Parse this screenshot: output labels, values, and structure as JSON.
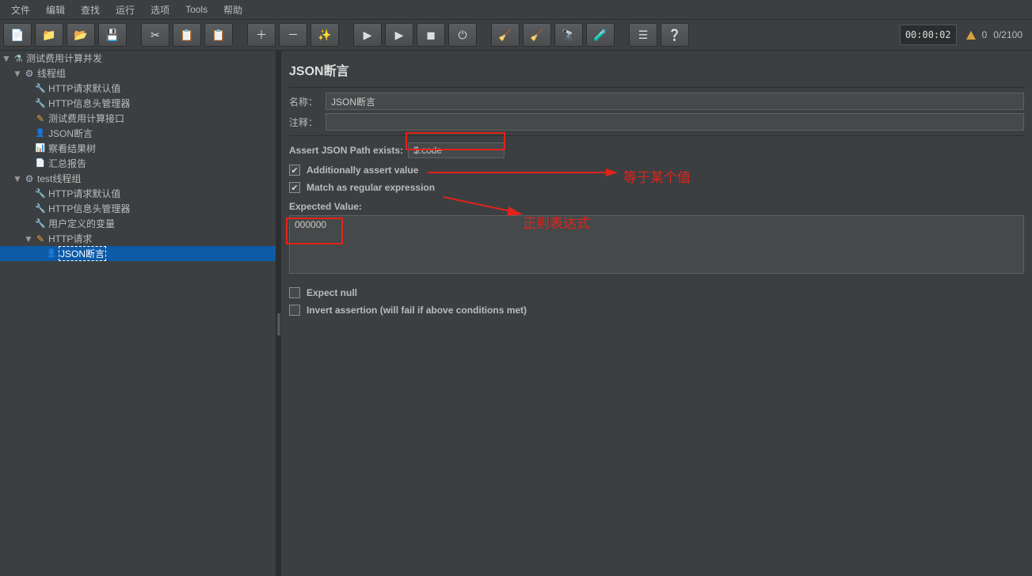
{
  "menu": {
    "items": [
      "文件",
      "编辑",
      "查找",
      "运行",
      "选项",
      "Tools",
      "帮助"
    ]
  },
  "toolbar": {
    "buttons": [
      {
        "name": "new-button",
        "glyph": "📄"
      },
      {
        "name": "templates-button",
        "glyph": "📁"
      },
      {
        "name": "open-button",
        "glyph": "📂"
      },
      {
        "name": "save-button",
        "glyph": "💾"
      },
      {
        "name": "sep"
      },
      {
        "name": "cut-button",
        "glyph": "✂"
      },
      {
        "name": "copy-button",
        "glyph": "📋"
      },
      {
        "name": "paste-button",
        "glyph": "📋"
      },
      {
        "name": "sep"
      },
      {
        "name": "plus-button",
        "glyph": "＋"
      },
      {
        "name": "minus-button",
        "glyph": "－"
      },
      {
        "name": "wand-button",
        "glyph": "✨"
      },
      {
        "name": "sep"
      },
      {
        "name": "start-button",
        "glyph": "▶"
      },
      {
        "name": "start-no-pause-button",
        "glyph": "▶"
      },
      {
        "name": "stop-button",
        "glyph": "◼"
      },
      {
        "name": "shutdown-button",
        "glyph": "⏻"
      },
      {
        "name": "sep"
      },
      {
        "name": "clear-button",
        "glyph": "🧹"
      },
      {
        "name": "clear-all-button",
        "glyph": "🧹"
      },
      {
        "name": "search-button",
        "glyph": "🔭"
      },
      {
        "name": "function-button",
        "glyph": "🧪"
      },
      {
        "name": "sep"
      },
      {
        "name": "toggle-log-button",
        "glyph": "☰"
      },
      {
        "name": "help-button",
        "glyph": "❔"
      }
    ],
    "timer": "00:00:02",
    "warn_count": "0",
    "thread_counter": "0/2100"
  },
  "tree": [
    {
      "indent": 0,
      "exp": "▼",
      "icon": "ic-flask",
      "label": "测试费用计算并发"
    },
    {
      "indent": 1,
      "exp": "▼",
      "icon": "ic-gear",
      "label": "线程组"
    },
    {
      "indent": 2,
      "exp": "",
      "icon": "ic-wrench",
      "label": "HTTP请求默认值"
    },
    {
      "indent": 2,
      "exp": "",
      "icon": "ic-wrench",
      "label": "HTTP信息头管理器"
    },
    {
      "indent": 2,
      "exp": "",
      "icon": "ic-pencil",
      "label": "测试费用计算接口"
    },
    {
      "indent": 2,
      "exp": "",
      "icon": "ic-person",
      "label": "JSON断言"
    },
    {
      "indent": 2,
      "exp": "",
      "icon": "ic-chart",
      "label": "察看结果树"
    },
    {
      "indent": 2,
      "exp": "",
      "icon": "ic-doc",
      "label": "汇总报告"
    },
    {
      "indent": 1,
      "exp": "▼",
      "icon": "ic-gear",
      "label": "test线程组"
    },
    {
      "indent": 2,
      "exp": "",
      "icon": "ic-wrench",
      "label": "HTTP请求默认值"
    },
    {
      "indent": 2,
      "exp": "",
      "icon": "ic-wrench",
      "label": "HTTP信息头管理器"
    },
    {
      "indent": 2,
      "exp": "",
      "icon": "ic-wrench",
      "label": "用户定义的变量"
    },
    {
      "indent": 2,
      "exp": "▼",
      "icon": "ic-pencil",
      "label": "HTTP请求"
    },
    {
      "indent": 3,
      "exp": "",
      "icon": "ic-person",
      "label": "JSON断言",
      "selected": true
    }
  ],
  "panel": {
    "title": "JSON断言",
    "name_label": "名称：",
    "name_value": "JSON断言",
    "comment_label": "注释：",
    "comment_value": "",
    "assert_path_label": "Assert JSON Path exists:",
    "assert_path_value": "$.code",
    "check_assert_value": "Additionally assert value",
    "check_regex": "Match as regular expression",
    "expected_label": "Expected Value:",
    "expected_value": "000000",
    "check_expect_null": "Expect null",
    "check_invert": "Invert assertion (will fail if above conditions met)"
  },
  "annotations": {
    "eq_value": "等于某个值",
    "regex": "正则表达式"
  }
}
